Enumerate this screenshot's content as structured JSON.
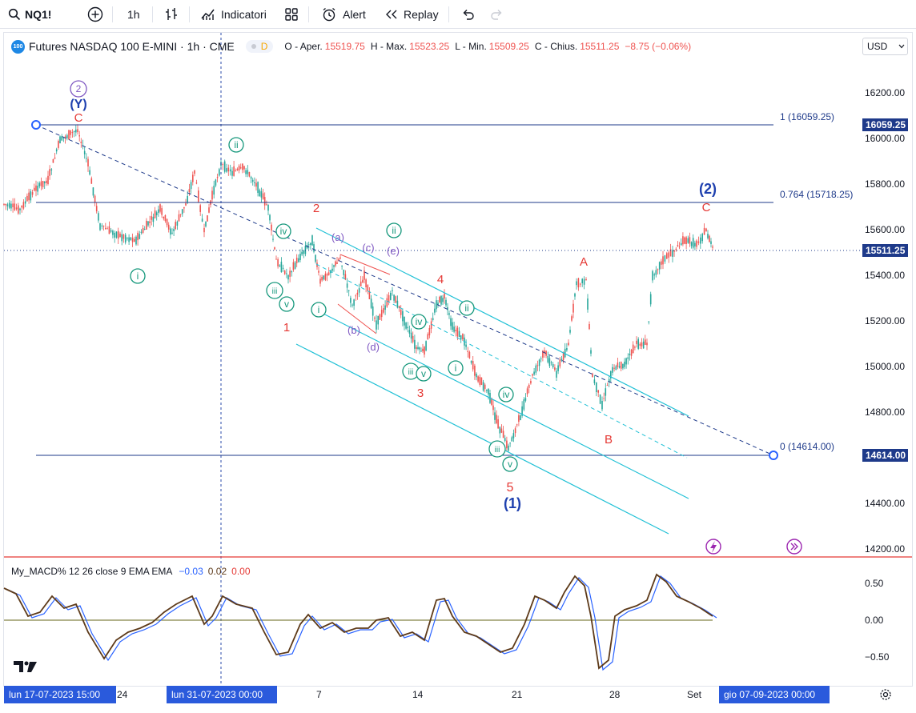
{
  "toolbar": {
    "symbol": "NQ1!",
    "interval": "1h",
    "indicators_label": "Indicatori",
    "alert_label": "Alert",
    "replay_label": "Replay"
  },
  "legend": {
    "title": "Futures NASDAQ 100 E-MINI · 1h · CME",
    "badge": "D",
    "open_label": "O - Aper.",
    "open": "15519.75",
    "high_label": "H - Max.",
    "high": "15523.25",
    "low_label": "L - Min.",
    "low": "15509.25",
    "close_label": "C - Chius.",
    "close": "15511.25",
    "change": "−8.75 (−0.06%)"
  },
  "currency": "USD",
  "macd_legend": {
    "name": "My_MACD% 12 26 close 9 EMA EMA",
    "v1": "−0.03",
    "v2": "0.02",
    "v3": "0.00"
  },
  "price_axis": [
    "16200.00",
    "16000.00",
    "15800.00",
    "15600.00",
    "15400.00",
    "15200.00",
    "15000.00",
    "14800.00",
    "14600.00",
    "14400.00",
    "14200.00"
  ],
  "price_tags": {
    "fib1": "16059.25",
    "last": "15511.25",
    "fib0": "14614.00"
  },
  "macd_axis": [
    "0.50",
    "0.00",
    "−0.50"
  ],
  "time_axis": {
    "start_highlight": "lun 17-07-2023   15:00",
    "mid_highlight": "lun 31-07-2023   00:00",
    "end_highlight": "gio 07-09-2023   00:00",
    "ticks": [
      "24",
      "7",
      "14",
      "21",
      "28",
      "Set"
    ]
  },
  "fib_labels": {
    "l1": "1 (16059.25)",
    "l764": "0.764 (15718.25)",
    "l0": "0 (14614.00)"
  },
  "wave_labels": {
    "w2_circle": "2",
    "Y": "(Y)",
    "C_top": "C",
    "ii_a": "ii",
    "i_a": "i",
    "iv_a": "iv",
    "iii_a": "iii",
    "v_a": "v",
    "one": "1",
    "two": "2",
    "a_p": "(a)",
    "b_p": "(b)",
    "c_p": "(c)",
    "d_p": "(d)",
    "e_p": "(e)",
    "ii_b": "ii",
    "i_b": "i",
    "iv_b": "iv",
    "iii_b": "iii",
    "v_b": "v",
    "three": "3",
    "four": "4",
    "ii_c": "ii",
    "i_c": "i",
    "iv_c": "iv",
    "iii_c": "iii",
    "v_c": "v",
    "five": "5",
    "W1": "(1)",
    "A": "A",
    "B": "B",
    "W2": "(2)",
    "C_right": "C"
  },
  "colors": {
    "up": "#26a69a",
    "down": "#ef5350",
    "fib": "#1e3a8a",
    "channel": "#22c1d6",
    "wave_red": "#e53935",
    "wave_green": "#16987c",
    "wave_purple": "#7e57c2",
    "wave_blue": "#1e40af",
    "macd_line": "#5d3a1a",
    "signal_line": "#2962ff"
  }
}
